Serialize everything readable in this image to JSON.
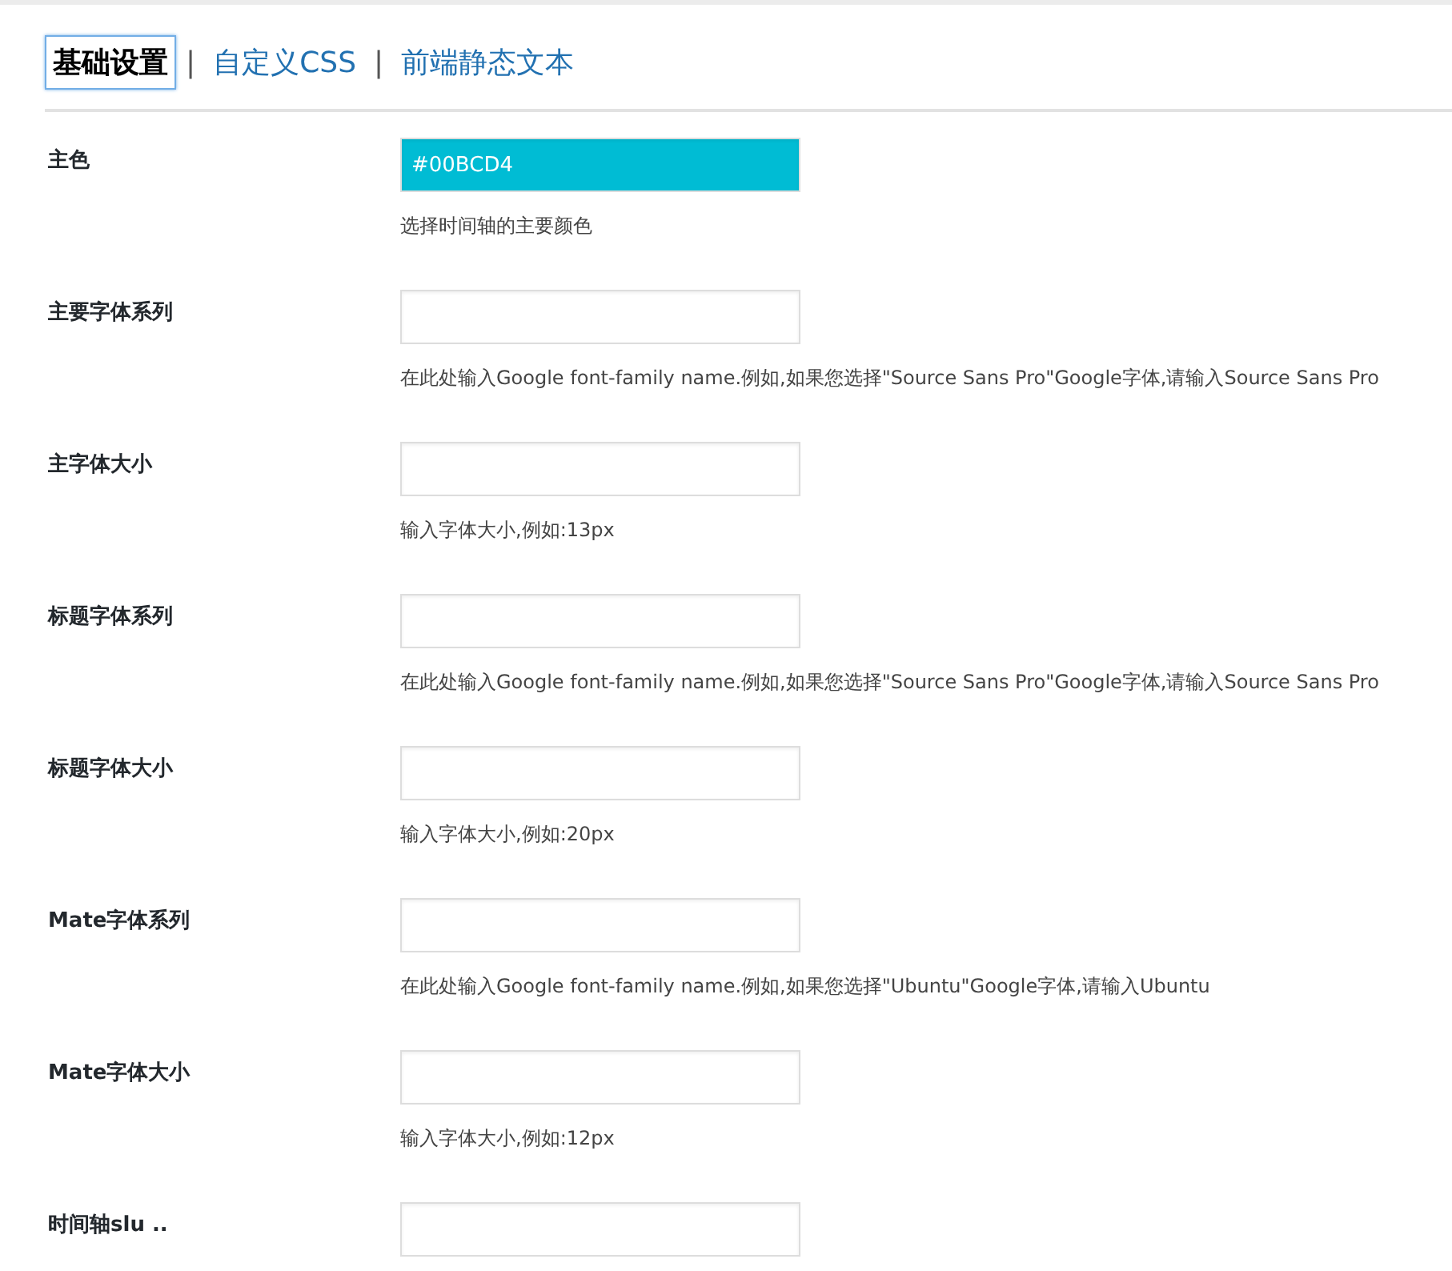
{
  "tabs": [
    {
      "label": "基础设置",
      "selected": true
    },
    {
      "label": "自定义CSS",
      "selected": false,
      "separator": "|"
    },
    {
      "label": "前端静态文本",
      "selected": false,
      "separator": "|"
    }
  ],
  "settings": [
    {
      "label": "主色",
      "kind": "color",
      "value": "#00BCD4",
      "hint": "选择时间轴的主要颜色"
    },
    {
      "label": "主要字体系列",
      "kind": "text",
      "hint": "在此处输入Google font-family name.例如,如果您选择\"Source Sans Pro\"Google字体,请输入Source Sans Pro"
    },
    {
      "label": "主字体大小",
      "kind": "text",
      "hint": "输入字体大小,例如:13px"
    },
    {
      "label": "标题字体系列",
      "kind": "text",
      "hint": "在此处输入Google font-family name.例如,如果您选择\"Source Sans Pro\"Google字体,请输入Source Sans Pro"
    },
    {
      "label": "标题字体大小",
      "kind": "text",
      "hint": "输入字体大小,例如:20px"
    },
    {
      "label": "Mate字体系列",
      "kind": "text",
      "hint": "在此处输入Google font-family name.例如,如果您选择\"Ubuntu\"Google字体,请输入Ubuntu"
    },
    {
      "label": "Mate字体大小",
      "kind": "text",
      "hint": "输入字体大小,例如:12px"
    },
    {
      "label": "时间轴slu ..",
      "kind": "text"
    }
  ]
}
